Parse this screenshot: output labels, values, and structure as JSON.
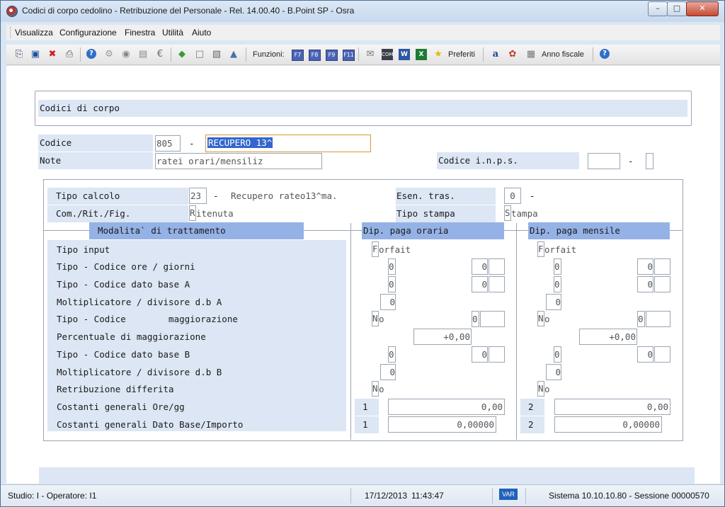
{
  "window": {
    "title": "Codici di corpo cedolino - Retribuzione del Personale - Rel. 14.00.40 - B.Point SP - Osra",
    "minimize": "–",
    "maximize": "□",
    "close": "✕"
  },
  "menu": [
    "Visualizza",
    "Configurazione",
    "Finestra",
    "Utilità",
    "Aiuto"
  ],
  "toolbar": {
    "funzioni_label": "Funzioni:",
    "fkeys": [
      "F7",
      "F8",
      "F9",
      "F11"
    ],
    "preferiti_label": "Preferiti",
    "anno_fiscale_label": "Anno fiscale",
    "icons": [
      "exit-icon",
      "save-icon",
      "delete-icon",
      "print-icon",
      "help-icon",
      "find-icon",
      "database-icon",
      "document-icon",
      "euro-icon",
      "layers-icon",
      "page-icon",
      "book-icon",
      "tag-icon",
      "mail-icon",
      "com-icon",
      "word-icon",
      "excel-icon",
      "star-icon",
      "font-icon",
      "palette-icon",
      "calendar-icon",
      "info-icon"
    ]
  },
  "form": {
    "title": "Codici di corpo",
    "codice_label": "Codice",
    "codice_value": "805",
    "dash": "-",
    "descrizione_value": "RECUPERO 13^",
    "note_label": "Note",
    "note_value": "ratei orari/mensiliz",
    "inps_label": "Codice i.n.p.s.",
    "inps_value": "",
    "inps_suffix": ""
  },
  "calc": {
    "tipo_calcolo_label": "Tipo calcolo",
    "tipo_calcolo_code": "23",
    "tipo_calcolo_desc": "Recupero rateo13^ma.",
    "esen_tras_label": "Esen. tras.",
    "esen_tras_value": "0",
    "com_rit_fig_label": "Com./Rit./Fig.",
    "com_rit_fig_first": "R",
    "com_rit_fig_rest": "itenuta",
    "tipo_stampa_label": "Tipo stampa",
    "tipo_stampa_first": "S",
    "tipo_stampa_rest": "tampa"
  },
  "sections": {
    "modalita": "Modalita` di trattamento",
    "oraria": "Dip. paga oraria",
    "mensile": "Dip. paga mensile"
  },
  "rows": [
    "Tipo input",
    "Tipo - Codice ore / giorni",
    "Tipo - Codice dato base A",
    "Moltiplicatore / divisore d.b A",
    "Tipo - Codice        maggiorazione",
    "Percentuale di maggiorazione",
    "Tipo - Codice dato base B",
    "Moltiplicatore / divisore d.b B",
    "Retribuzione differita",
    "Costanti generali Ore/gg",
    "Costanti generali Dato Base/Importo"
  ],
  "oraria": {
    "tipo_input_first": "F",
    "tipo_input_rest": "orfait",
    "ore_tipo": "0",
    "ore_codice": "0",
    "dba_tipo": "0",
    "dba_codice": "0",
    "molt_a": "0",
    "magg_first": "N",
    "magg_rest": "o",
    "magg_codice": "0",
    "percentuale": "+0,00",
    "dbb_tipo": "0",
    "dbb_codice": "0",
    "molt_b": "0",
    "retr_first": "N",
    "retr_rest": "o",
    "cost_ore_num": "1",
    "cost_ore_val": "0,00",
    "cost_db_num": "1",
    "cost_db_val": "0,00000"
  },
  "mensile": {
    "tipo_input_first": "F",
    "tipo_input_rest": "orfait",
    "ore_tipo": "0",
    "ore_codice": "0",
    "dba_tipo": "0",
    "dba_codice": "0",
    "molt_a": "0",
    "magg_first": "N",
    "magg_rest": "o",
    "magg_codice": "0",
    "percentuale": "+0,00",
    "dbb_tipo": "0",
    "dbb_codice": "0",
    "molt_b": "0",
    "retr_first": "N",
    "retr_rest": "o",
    "cost_ore_num": "2",
    "cost_ore_val": "0,00",
    "cost_db_num": "2",
    "cost_db_val": "0,00000"
  },
  "status": {
    "studio": "Studio: I - Operatore: I1",
    "date": "17/12/2013",
    "time": "11:43:47",
    "var": "VAR",
    "sistema": "Sistema 10.10.10.80 - Sessione 00000570"
  }
}
